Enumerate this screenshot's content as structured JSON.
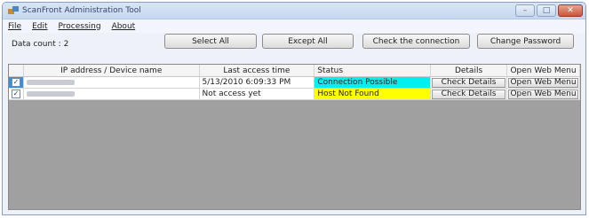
{
  "window": {
    "title": "ScanFront Administration Tool"
  },
  "colors": {
    "status_ok": "#00f0f0",
    "status_fail": "#ffff00",
    "selection": "#3a8fd8"
  },
  "menu": [
    {
      "label": "File"
    },
    {
      "label": "Edit"
    },
    {
      "label": "Processing"
    },
    {
      "label": "About"
    }
  ],
  "toolbar": {
    "data_count_label": "Data count :",
    "data_count_value": "2",
    "select_all": "Select All",
    "except_all": "Except All",
    "check_connection": "Check the connection",
    "change_password": "Change Password"
  },
  "table": {
    "headers": [
      "",
      "IP address / Device name",
      "Last access time",
      "Status",
      "Details",
      "Open Web Menu"
    ],
    "rows": [
      {
        "checked": true,
        "ip": "",
        "last_access": "5/13/2010 6:09:33 PM",
        "status": "Connection Possible",
        "details": "Check Details",
        "web": "Open Web Menu"
      },
      {
        "checked": true,
        "ip": "",
        "last_access": "Not access yet",
        "status": "Host Not Found",
        "details": "Check Details",
        "web": "Open Web Menu"
      }
    ]
  }
}
